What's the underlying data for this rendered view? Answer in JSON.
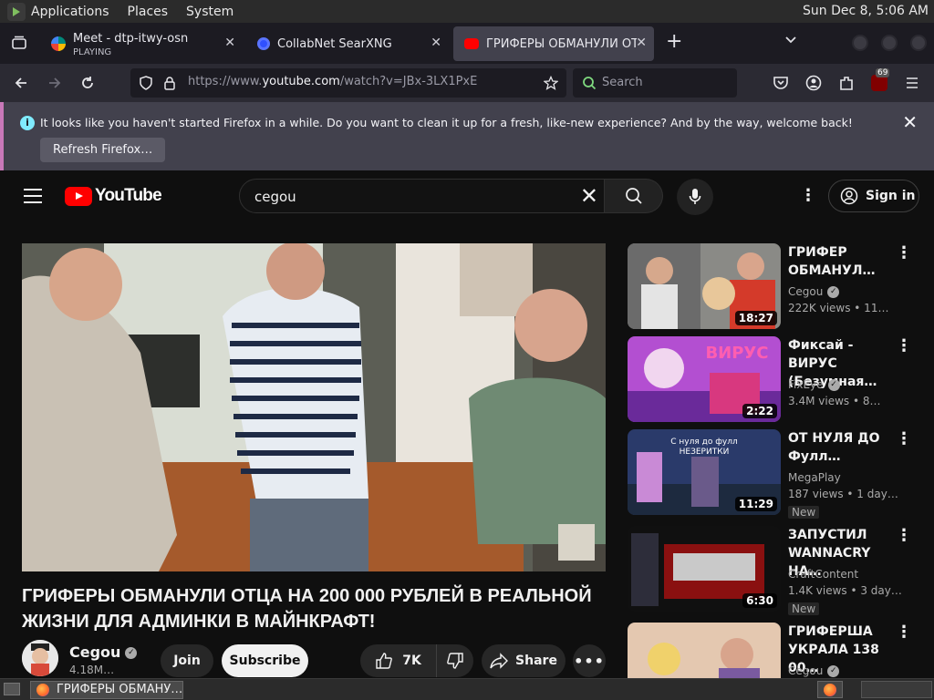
{
  "system_bar": {
    "menus": [
      "Applications",
      "Places",
      "System"
    ],
    "clock": "Sun Dec  8,  5:06 AM"
  },
  "tabs": [
    {
      "title": "Meet - dtp-itwy-osn",
      "subtitle": "PLAYING",
      "icon": "meet-icon"
    },
    {
      "title": "CollabNet SearXNG",
      "icon": "searx-icon"
    },
    {
      "title": "ГРИФЕРЫ ОБМАНУЛИ ОТ",
      "icon": "youtube-icon",
      "active": true
    }
  ],
  "navbar": {
    "url_prefix": "https://www.",
    "url_domain": "youtube.com",
    "url_rest": "/watch?v=JBx-3LX1PxE",
    "search_placeholder": "Search",
    "addon_badge": "69"
  },
  "notification": {
    "message": "It looks like you haven't started Firefox in a while. Do you want to clean it up for a fresh, like-new experience? And by the way, welcome back!",
    "button": "Refresh Firefox…"
  },
  "youtube": {
    "logo_text": "YouTube",
    "search_query": "cegou",
    "sign_in": "Sign in",
    "video": {
      "title": "ГРИФЕРЫ ОБМАНУЛИ ОТЦА НА 200 000 РУБЛЕЙ В РЕАЛЬНОЙ ЖИЗНИ ДЛЯ АДМИНКИ В МАЙНКРАФТ!",
      "channel": "Cegou",
      "subscribers": "4.18M…",
      "join": "Join",
      "subscribe": "Subscribe",
      "likes": "7K",
      "share": "Share"
    },
    "recommendations": [
      {
        "title": "ГРИФЕР ОБМАНУЛ…",
        "channel": "Cegou",
        "meta": "222K views  •  11…",
        "duration": "18:27",
        "verified": true,
        "badge": ""
      },
      {
        "title": "Фиксай - ВИРУС (Безумная…",
        "channel": "FixEye",
        "meta": "3.4M views  •  8…",
        "duration": "2:22",
        "verified": true,
        "badge": ""
      },
      {
        "title": "ОТ НУЛЯ ДО Фулл…",
        "channel": "MegaPlay",
        "meta": "187 views  •  1 day…",
        "duration": "11:29",
        "verified": false,
        "badge": "New"
      },
      {
        "title": "ЗАПУСТИЛ WANNACRY НА…",
        "channel": "CraftContent",
        "meta": "1.4K views  •  3 day…",
        "duration": "6:30",
        "verified": false,
        "badge": "New"
      },
      {
        "title": "ГРИФЕРША УКРАЛА 138 00…",
        "channel": "Cegou",
        "meta": "",
        "duration": "",
        "verified": true,
        "badge": ""
      }
    ],
    "thumb_texts": {
      "virus": "ВИРУС",
      "nub_line1": "С нуля до фулл",
      "nub_line2": "НЕЗЕРИТКИ"
    }
  },
  "taskbar": {
    "window_title": "ГРИФЕРЫ ОБМАНУ…"
  },
  "colors": {
    "yt_red": "#ff0000",
    "firefox_bg": "#2b2a33",
    "notice_accent": "#c878b8"
  }
}
